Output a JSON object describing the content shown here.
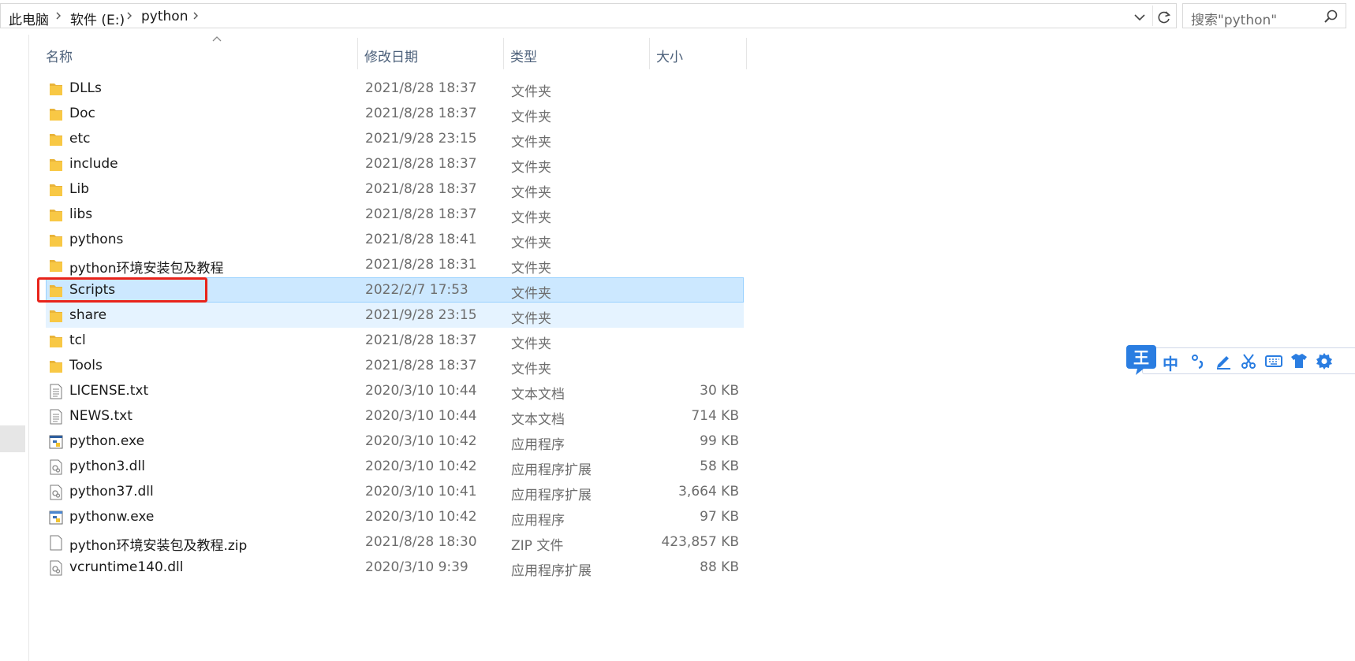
{
  "breadcrumb": {
    "items": [
      "此电脑",
      "软件 (E:)",
      "python"
    ]
  },
  "search": {
    "placeholder": "搜索\"python\""
  },
  "columns": {
    "name": "名称",
    "date": "修改日期",
    "type": "类型",
    "size": "大小"
  },
  "files": [
    {
      "name": "DLLs",
      "date": "2021/8/28 18:37",
      "type": "文件夹",
      "size": "",
      "icon": "folder-icon"
    },
    {
      "name": "Doc",
      "date": "2021/8/28 18:37",
      "type": "文件夹",
      "size": "",
      "icon": "folder-icon"
    },
    {
      "name": "etc",
      "date": "2021/9/28 23:15",
      "type": "文件夹",
      "size": "",
      "icon": "folder-icon"
    },
    {
      "name": "include",
      "date": "2021/8/28 18:37",
      "type": "文件夹",
      "size": "",
      "icon": "folder-icon"
    },
    {
      "name": "Lib",
      "date": "2021/8/28 18:37",
      "type": "文件夹",
      "size": "",
      "icon": "folder-icon"
    },
    {
      "name": "libs",
      "date": "2021/8/28 18:37",
      "type": "文件夹",
      "size": "",
      "icon": "folder-icon"
    },
    {
      "name": "pythons",
      "date": "2021/8/28 18:41",
      "type": "文件夹",
      "size": "",
      "icon": "folder-icon"
    },
    {
      "name": "python环境安装包及教程",
      "date": "2021/8/28 18:31",
      "type": "文件夹",
      "size": "",
      "icon": "folder-icon"
    },
    {
      "name": "Scripts",
      "date": "2022/2/7 17:53",
      "type": "文件夹",
      "size": "",
      "icon": "folder-icon"
    },
    {
      "name": "share",
      "date": "2021/9/28 23:15",
      "type": "文件夹",
      "size": "",
      "icon": "folder-icon"
    },
    {
      "name": "tcl",
      "date": "2021/8/28 18:37",
      "type": "文件夹",
      "size": "",
      "icon": "folder-icon"
    },
    {
      "name": "Tools",
      "date": "2021/8/28 18:37",
      "type": "文件夹",
      "size": "",
      "icon": "folder-icon"
    },
    {
      "name": "LICENSE.txt",
      "date": "2020/3/10 10:44",
      "type": "文本文档",
      "size": "30 KB",
      "icon": "text-file-icon"
    },
    {
      "name": "NEWS.txt",
      "date": "2020/3/10 10:44",
      "type": "文本文档",
      "size": "714 KB",
      "icon": "text-file-icon"
    },
    {
      "name": "python.exe",
      "date": "2020/3/10 10:42",
      "type": "应用程序",
      "size": "99 KB",
      "icon": "python-exe-icon"
    },
    {
      "name": "python3.dll",
      "date": "2020/3/10 10:42",
      "type": "应用程序扩展",
      "size": "58 KB",
      "icon": "dll-file-icon"
    },
    {
      "name": "python37.dll",
      "date": "2020/3/10 10:41",
      "type": "应用程序扩展",
      "size": "3,664 KB",
      "icon": "dll-file-icon"
    },
    {
      "name": "pythonw.exe",
      "date": "2020/3/10 10:42",
      "type": "应用程序",
      "size": "97 KB",
      "icon": "pythonw-exe-icon"
    },
    {
      "name": "python环境安装包及教程.zip",
      "date": "2021/8/28 18:30",
      "type": "ZIP 文件",
      "size": "423,857 KB",
      "icon": "zip-file-icon"
    },
    {
      "name": "vcruntime140.dll",
      "date": "2020/3/10 9:39",
      "type": "应用程序扩展",
      "size": "88 KB",
      "icon": "dll-file-icon"
    }
  ],
  "selected_row": "Scripts",
  "hovered_row": "share",
  "highlighted_item": "Scripts",
  "ime_toolbar": {
    "logo": "王",
    "mode": "中",
    "buttons": [
      "punctuation-icon",
      "pen-icon",
      "scissors-icon",
      "keyboard-icon",
      "skin-shirt-icon",
      "settings-gear-icon"
    ]
  },
  "colors": {
    "selection_bg": "#cce8ff",
    "selection_border": "#99d1ff",
    "hover_bg": "#e5f3ff",
    "annotation_red": "#e8231a",
    "folder_yellow": "#f8c845",
    "ime_blue": "#2a7de1"
  }
}
